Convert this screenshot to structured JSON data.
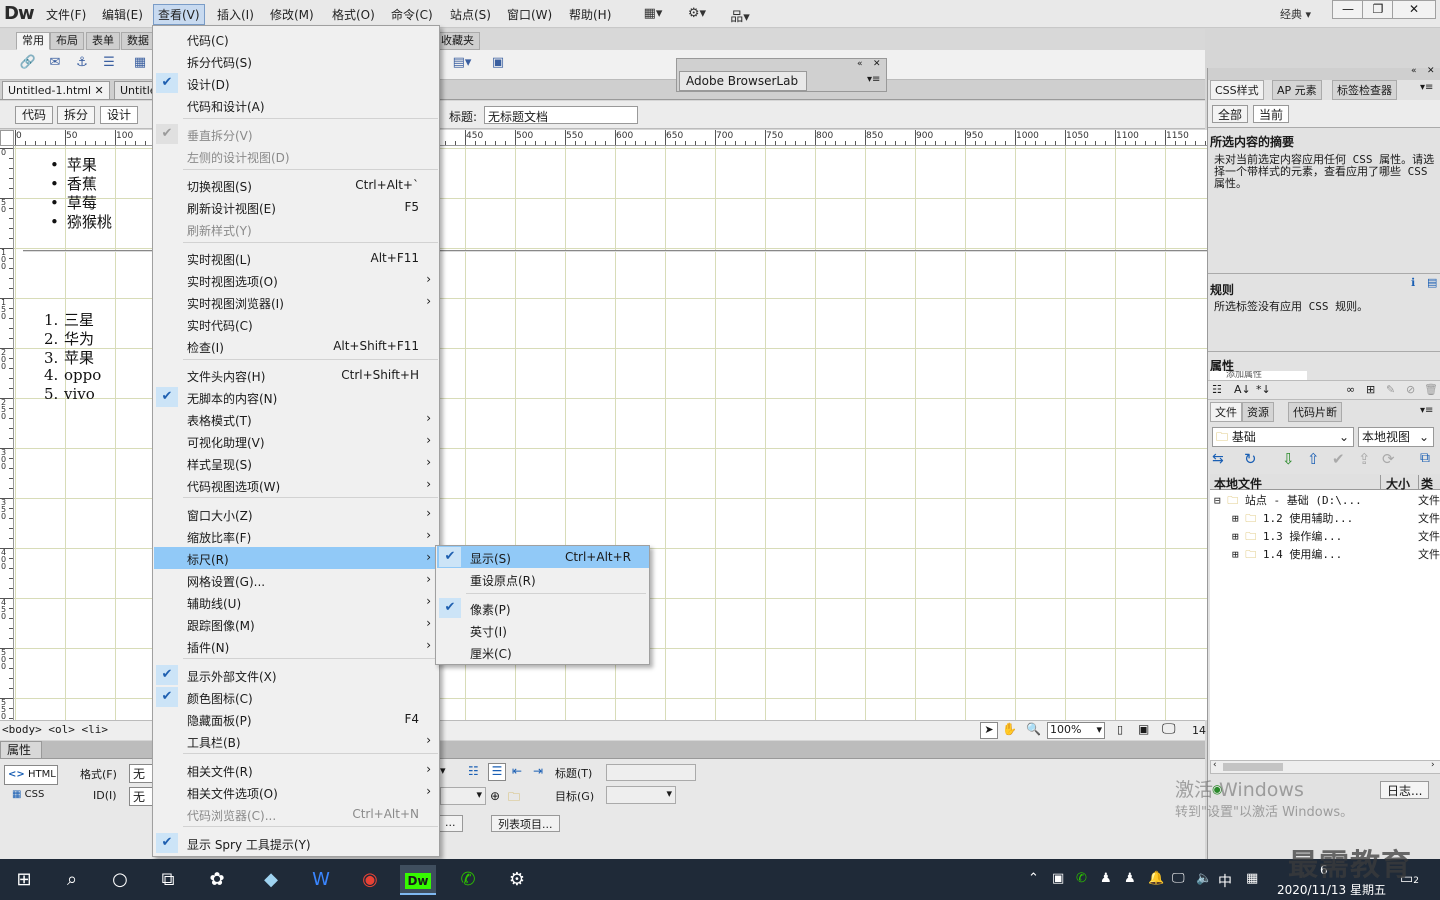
{
  "app": {
    "logo": "Dw",
    "menus": [
      "文件(F)",
      "编辑(E)",
      "查看(V)",
      "插入(I)",
      "修改(M)",
      "格式(O)",
      "命令(C)",
      "站点(S)",
      "窗口(W)",
      "帮助(H)"
    ],
    "workspace": "经典",
    "window_buttons": [
      "—",
      "❐",
      "✕"
    ]
  },
  "insert_tabs": [
    "常用",
    "布局",
    "表单",
    "数据",
    "收藏夹"
  ],
  "doc_tabs": [
    "Untitled-1.html",
    "Untitle"
  ],
  "view_buttons": [
    "代码",
    "拆分",
    "设计"
  ],
  "title_label": "标题:",
  "title_value": "无标题文档",
  "ruler_labels": [
    "0",
    "50",
    "100",
    "450",
    "500",
    "550",
    "600",
    "650",
    "700",
    "750",
    "800",
    "850",
    "900",
    "950",
    "1000",
    "1050",
    "1100",
    "1150"
  ],
  "vruler_labels": [
    "0",
    "5 0",
    "1 0 0",
    "1 5 0",
    "2 0 0",
    "2 5 0",
    "3 0 0",
    "3 5 0",
    "4 0 0",
    "4 5 0",
    "5 0 0",
    "5 5 0"
  ],
  "design": {
    "ul_items": [
      "苹果",
      "香蕉",
      "草莓",
      "猕猴桃"
    ],
    "ol_items": [
      "三星",
      "华为",
      "苹果",
      "oppo",
      "vivo"
    ],
    "ol_numbers": [
      "1.",
      "2.",
      "3.",
      "4.",
      "5."
    ]
  },
  "status": {
    "tag_path": "<body> <ol> <li>",
    "zoom": "100%",
    "size_text": "14"
  },
  "browserlab": {
    "title": "Adobe BrowserLab"
  },
  "view_menu": {
    "items": [
      {
        "label": "代码(C)",
        "shortcut": "",
        "check": false,
        "arrow": false,
        "disabled": false
      },
      {
        "label": "拆分代码(S)",
        "shortcut": "",
        "check": false,
        "arrow": false,
        "disabled": false
      },
      {
        "label": "设计(D)",
        "shortcut": "",
        "check": true,
        "arrow": false,
        "disabled": false
      },
      {
        "label": "代码和设计(A)",
        "shortcut": "",
        "check": false,
        "arrow": false,
        "disabled": false
      },
      {
        "label": "垂直拆分(V)",
        "shortcut": "",
        "check": true,
        "arrow": false,
        "disabled": true
      },
      {
        "label": "左侧的设计视图(D)",
        "shortcut": "",
        "check": false,
        "arrow": false,
        "disabled": true
      },
      {
        "label": "切换视图(S)",
        "shortcut": "Ctrl+Alt+`",
        "check": false,
        "arrow": false,
        "disabled": false
      },
      {
        "label": "刷新设计视图(E)",
        "shortcut": "F5",
        "check": false,
        "arrow": false,
        "disabled": false
      },
      {
        "label": "刷新样式(Y)",
        "shortcut": "",
        "check": false,
        "arrow": false,
        "disabled": true
      },
      {
        "label": "实时视图(L)",
        "shortcut": "Alt+F11",
        "check": false,
        "arrow": false,
        "disabled": false
      },
      {
        "label": "实时视图选项(O)",
        "shortcut": "",
        "check": false,
        "arrow": true,
        "disabled": false
      },
      {
        "label": "实时视图浏览器(I)",
        "shortcut": "",
        "check": false,
        "arrow": true,
        "disabled": false
      },
      {
        "label": "实时代码(C)",
        "shortcut": "",
        "check": false,
        "arrow": false,
        "disabled": false
      },
      {
        "label": "检查(I)",
        "shortcut": "Alt+Shift+F11",
        "check": false,
        "arrow": false,
        "disabled": false
      },
      {
        "label": "文件头内容(H)",
        "shortcut": "Ctrl+Shift+H",
        "check": false,
        "arrow": false,
        "disabled": false
      },
      {
        "label": "无脚本的内容(N)",
        "shortcut": "",
        "check": true,
        "arrow": false,
        "disabled": false
      },
      {
        "label": "表格模式(T)",
        "shortcut": "",
        "check": false,
        "arrow": true,
        "disabled": false
      },
      {
        "label": "可视化助理(V)",
        "shortcut": "",
        "check": false,
        "arrow": true,
        "disabled": false
      },
      {
        "label": "样式呈现(S)",
        "shortcut": "",
        "check": false,
        "arrow": true,
        "disabled": false
      },
      {
        "label": "代码视图选项(W)",
        "shortcut": "",
        "check": false,
        "arrow": true,
        "disabled": false
      },
      {
        "label": "窗口大小(Z)",
        "shortcut": "",
        "check": false,
        "arrow": true,
        "disabled": false
      },
      {
        "label": "缩放比率(F)",
        "shortcut": "",
        "check": false,
        "arrow": true,
        "disabled": false
      },
      {
        "label": "标尺(R)",
        "shortcut": "",
        "check": false,
        "arrow": true,
        "disabled": false,
        "highlight": true
      },
      {
        "label": "网格设置(G)...",
        "shortcut": "",
        "check": false,
        "arrow": true,
        "disabled": false
      },
      {
        "label": "辅助线(U)",
        "shortcut": "",
        "check": false,
        "arrow": true,
        "disabled": false
      },
      {
        "label": "跟踪图像(M)",
        "shortcut": "",
        "check": false,
        "arrow": true,
        "disabled": false
      },
      {
        "label": "插件(N)",
        "shortcut": "",
        "check": false,
        "arrow": true,
        "disabled": false
      },
      {
        "label": "显示外部文件(X)",
        "shortcut": "",
        "check": true,
        "arrow": false,
        "disabled": false
      },
      {
        "label": "颜色图标(C)",
        "shortcut": "",
        "check": true,
        "arrow": false,
        "disabled": false
      },
      {
        "label": "隐藏面板(P)",
        "shortcut": "F4",
        "check": false,
        "arrow": false,
        "disabled": false
      },
      {
        "label": "工具栏(B)",
        "shortcut": "",
        "check": false,
        "arrow": true,
        "disabled": false
      },
      {
        "label": "相关文件(R)",
        "shortcut": "",
        "check": false,
        "arrow": true,
        "disabled": false
      },
      {
        "label": "相关文件选项(O)",
        "shortcut": "",
        "check": false,
        "arrow": true,
        "disabled": false
      },
      {
        "label": "代码浏览器(C)...",
        "shortcut": "Ctrl+Alt+N",
        "check": false,
        "arrow": false,
        "disabled": true
      },
      {
        "label": "显示 Spry 工具提示(Y)",
        "shortcut": "",
        "check": true,
        "arrow": false,
        "disabled": false
      }
    ]
  },
  "ruler_submenu": {
    "items": [
      {
        "label": "显示(S)",
        "shortcut": "Ctrl+Alt+R",
        "check": true,
        "highlight": true
      },
      {
        "label": "重设原点(R)",
        "shortcut": "",
        "check": false
      },
      {
        "label": "像素(P)",
        "shortcut": "",
        "check": true
      },
      {
        "label": "英寸(I)",
        "shortcut": "",
        "check": false
      },
      {
        "label": "厘米(C)",
        "shortcut": "",
        "check": false
      }
    ]
  },
  "properties": {
    "title": "属性",
    "html_btn": "HTML",
    "css_btn": "CSS",
    "format_label": "格式(F)",
    "format_value": "无",
    "id_label": "ID(I)",
    "id_value": "无",
    "title_label": "标题(T)",
    "target_label": "目标(G)",
    "list_item_btn": "列表项目...",
    "dots_btn": "..."
  },
  "right_panel": {
    "css_tabs": [
      "CSS样式",
      "AP 元素",
      "标签检查器"
    ],
    "mode_tabs": [
      "全部",
      "当前"
    ],
    "summary_title": "所选内容的摘要",
    "summary_text": "未对当前选定内容应用任何 CSS 属性。请选择一个带样式的元素，查看应用了哪些 CSS 属性。",
    "rules_title": "规则",
    "rules_text": "所选标签没有应用 CSS 规则。",
    "props_title": "属性",
    "add_prop": "添加属性",
    "file_tabs": [
      "文件",
      "资源",
      "代码片断"
    ],
    "site_select": "基础",
    "view_select": "本地视图",
    "col_local": "本地文件",
    "col_size": "大小",
    "col_type": "类型",
    "tree": [
      {
        "label": "站点 - 基础 (D:\\...",
        "type": "文件"
      },
      {
        "label": "1.2 使用辅助...",
        "type": "文件"
      },
      {
        "label": "1.3 操作编...",
        "type": "文件"
      },
      {
        "label": "1.4 使用编...",
        "type": "文件"
      }
    ],
    "log_btn": "日志..."
  },
  "watermark": {
    "line1": "激活 Windows",
    "line2": "转到\"设置\"以激活 Windows。",
    "brand": "最需教育"
  },
  "taskbar": {
    "ime": "中",
    "date": "2020/11/13 星期五",
    "time": "6",
    "notif_count": "2"
  }
}
